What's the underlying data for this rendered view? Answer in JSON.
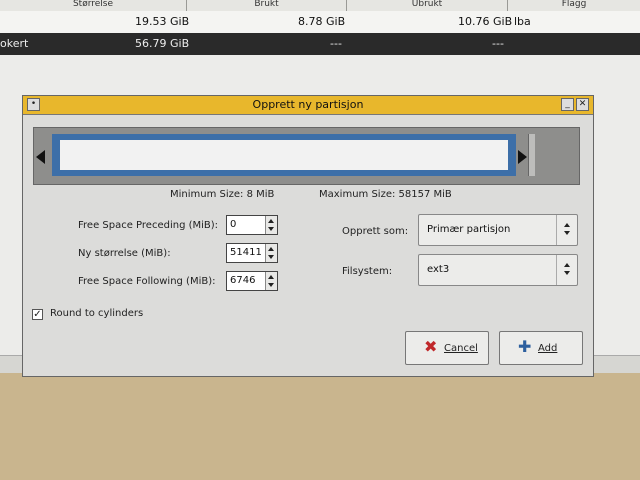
{
  "table": {
    "columns": [
      "Størrelse",
      "Brukt",
      "Ubrukt",
      "Flagg"
    ],
    "rows": [
      {
        "size": "19.53 GiB",
        "used": "8.78 GiB",
        "unused": "10.76 GiB",
        "flags": "lba",
        "label": ""
      },
      {
        "size": "56.79 GiB",
        "used": "---",
        "unused": "---",
        "flags": "",
        "label": "okert"
      }
    ]
  },
  "dialog": {
    "title": "Opprett ny partisjon",
    "min_size": "Minimum Size: 8 MiB",
    "max_size": "Maximum Size: 58157 MiB",
    "fields": {
      "preceding_label": "Free Space Preceding (MiB):",
      "preceding_value": "0",
      "new_size_label": "Ny størrelse (MiB):",
      "new_size_value": "51411",
      "following_label": "Free Space Following (MiB):",
      "following_value": "6746"
    },
    "create_as_label": "Opprett som:",
    "create_as_value": "Primær partisjon",
    "filesystem_label": "Filsystem:",
    "filesystem_value": "ext3",
    "round_label": "Round to cylinders",
    "round_checked": true,
    "cancel_label": "Cancel",
    "add_label": "Add",
    "colors": {
      "titlebar": "#e8b72c",
      "partition_bar": "#3d6fa8"
    },
    "icons": {
      "cancel": "cancel-x-icon",
      "add": "add-plus-icon"
    }
  }
}
